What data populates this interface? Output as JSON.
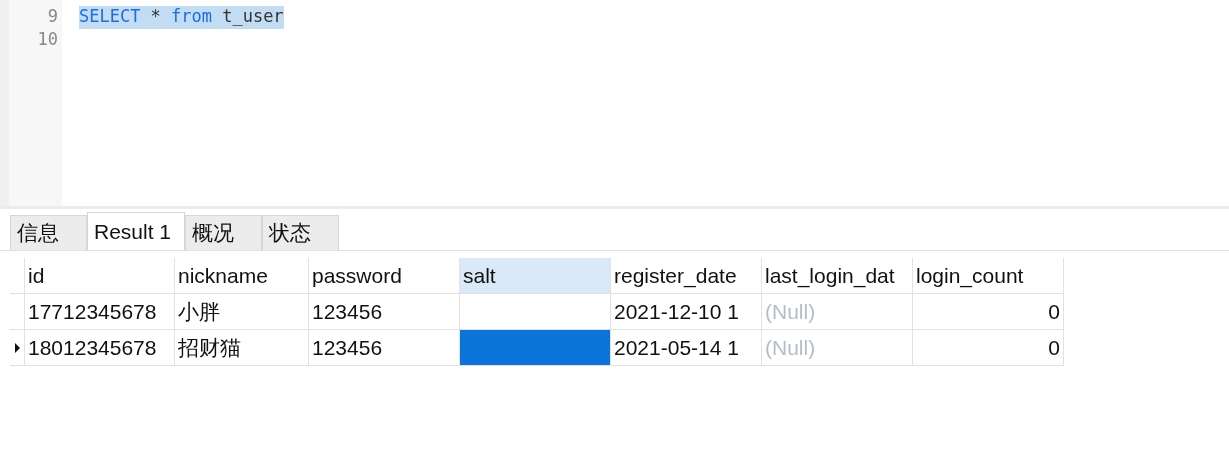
{
  "editor": {
    "lines": [
      {
        "number": "9",
        "selected": true,
        "tokens": [
          {
            "kind": "keyword",
            "text": "SELECT"
          },
          {
            "kind": "plain",
            "text": "*"
          },
          {
            "kind": "keyword",
            "text": "from"
          },
          {
            "kind": "plain",
            "text": "t_user"
          }
        ]
      },
      {
        "number": "10"
      }
    ]
  },
  "tabs": [
    {
      "label": "信息",
      "selected": false
    },
    {
      "label": "Result 1",
      "selected": true
    },
    {
      "label": "概况",
      "selected": false
    },
    {
      "label": "状态",
      "selected": false
    }
  ],
  "table": {
    "columns": [
      {
        "label": "id",
        "selected": false
      },
      {
        "label": "nickname",
        "selected": false
      },
      {
        "label": "password",
        "selected": false
      },
      {
        "label": "salt",
        "selected": true
      },
      {
        "label": "register_date",
        "selected": false
      },
      {
        "label": "last_login_dat",
        "selected": false
      },
      {
        "label": "login_count",
        "selected": false
      }
    ],
    "rows": [
      {
        "selected": false,
        "cells": [
          {
            "kind": "text",
            "text": "17712345678",
            "selected": false
          },
          {
            "kind": "text",
            "text": "小胖",
            "selected": false
          },
          {
            "kind": "text",
            "text": "123456",
            "selected": false
          },
          {
            "kind": "text",
            "selected": false
          },
          {
            "kind": "text",
            "text": "2021-12-10 1",
            "selected": false
          },
          {
            "kind": "null",
            "text": "(Null)",
            "selected": false
          },
          {
            "kind": "number",
            "text": "0",
            "selected": false
          }
        ]
      },
      {
        "selected": true,
        "cells": [
          {
            "kind": "text",
            "text": "18012345678",
            "selected": false
          },
          {
            "kind": "text",
            "text": "招财猫",
            "selected": false
          },
          {
            "kind": "text",
            "text": "123456",
            "selected": false
          },
          {
            "kind": "text",
            "selected": true
          },
          {
            "kind": "text",
            "text": "2021-05-14 1",
            "selected": false
          },
          {
            "kind": "null",
            "text": "(Null)",
            "selected": false
          },
          {
            "kind": "number",
            "text": "0",
            "selected": false
          }
        ]
      }
    ]
  }
}
